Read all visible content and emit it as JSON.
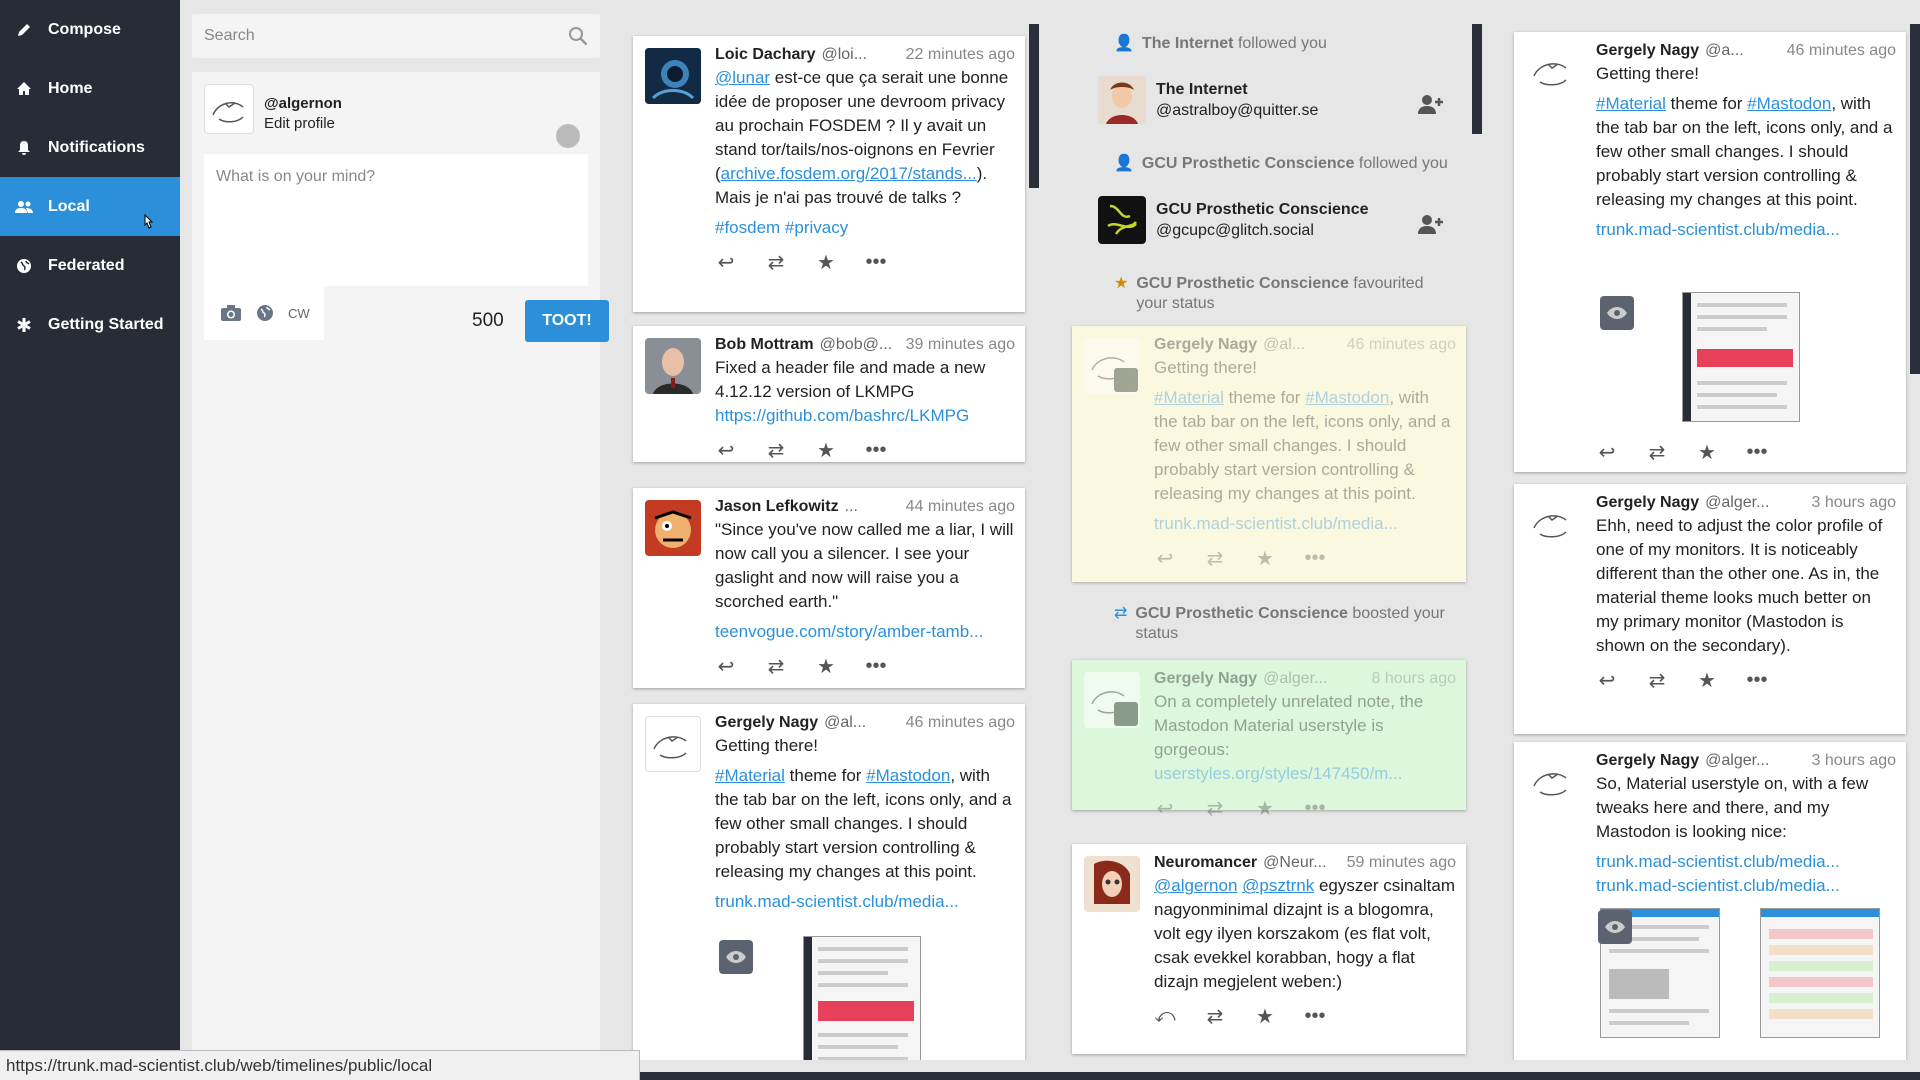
{
  "sidebar": {
    "items": [
      {
        "label": "Compose",
        "icon": "pencil-icon"
      },
      {
        "label": "Home",
        "icon": "home-icon"
      },
      {
        "label": "Notifications",
        "icon": "bell-icon"
      },
      {
        "label": "Local",
        "icon": "users-icon",
        "active": true
      },
      {
        "label": "Federated",
        "icon": "globe-icon"
      },
      {
        "label": "Getting Started",
        "icon": "asterisk-icon"
      }
    ]
  },
  "compose": {
    "search_placeholder": "Search",
    "handle": "@algernon",
    "edit_profile": "Edit profile",
    "placeholder": "What is on your mind?",
    "cw_label": "CW",
    "counter": "500",
    "toot_label": "TOOT!"
  },
  "local": {
    "statuses": [
      {
        "name": "Loic Dachary",
        "acct": "@loi...",
        "time": "22 minutes ago",
        "mention": "@lunar",
        "text1": " est-ce que ça serait une bonne idée de proposer une devroom privacy au prochain FOSDEM ? Il y avait un stand tor/tails/nos-oignons en Fevrier (",
        "link": "archive.fosdem.org/2017/stands...",
        "text2": "). Mais je n'ai pas trouvé de talks ?",
        "tags": "#fosdem #privacy"
      },
      {
        "name": "Bob Mottram",
        "acct": "@bob@...",
        "time": "39 minutes ago",
        "text": "Fixed a header file and made a new 4.12.12 version of LKMPG",
        "link": "https://github.com/bashrc/LKMPG"
      },
      {
        "name": "Jason Lefkowitz",
        "acct": "...",
        "time": "44 minutes ago",
        "text": "\"Since you've now called me a liar, I will now call you a silencer. I see your gaslight and now will raise you a scorched earth.\"",
        "link": "teenvogue.com/story/amber-tamb..."
      },
      {
        "name": "Gergely Nagy",
        "acct": "@al...",
        "time": "46 minutes ago",
        "line1": "Getting there!",
        "tag1": "#Material",
        "mid": " theme for ",
        "tag2": "#Mastodon",
        "rest": ", with the tab bar on the left, icons only, and a few other small changes. I should probably start version controlling & releasing my changes at this point.",
        "link": "trunk.mad-scientist.club/media..."
      }
    ]
  },
  "notifications": {
    "n1": {
      "who": "The Internet",
      "what": "followed you",
      "name": "The Internet",
      "acct": "@astralboy@quitter.se"
    },
    "n2": {
      "who": "GCU Prosthetic Conscience",
      "what": "followed you",
      "name": "GCU Prosthetic Conscience",
      "acct": "@gcupc@glitch.social"
    },
    "n3": {
      "who": "GCU Prosthetic Conscience",
      "what": "favourited your status",
      "name": "Gergely Nagy",
      "acct": "@al...",
      "time": "46 minutes ago",
      "line1": "Getting there!",
      "tag1": "#Material",
      "mid": " theme for ",
      "tag2": "#Mastodon",
      "rest": ", with the tab bar on the left, icons only, and a few other small changes. I should probably start version controlling & releasing my changes at this point.",
      "link": "trunk.mad-scientist.club/media..."
    },
    "n4": {
      "who": "GCU Prosthetic Conscience",
      "what": "boosted your status",
      "name": "Gergely Nagy",
      "acct": "@alger...",
      "time": "8 hours ago",
      "text": "On a completely unrelated note, the Mastodon Material userstyle is gorgeous:",
      "link": "userstyles.org/styles/147450/m..."
    },
    "n5": {
      "name": "Neuromancer",
      "acct": "@Neur...",
      "time": "59 minutes ago",
      "m1": "@algernon",
      "m2": "@psztrnk",
      "text": " egyszer csinaltam nagyonminimal dizajnt is a blogomra, volt egy ilyen korszakom (es flat volt, csak evekkel korabban, hogy a flat dizajn megjelent weben:)"
    }
  },
  "home": {
    "statuses": [
      {
        "name": "Gergely Nagy",
        "acct": "@a...",
        "time": "46 minutes ago",
        "line1": "Getting there!",
        "tag1": "#Material",
        "mid": " theme for ",
        "tag2": "#Mastodon",
        "rest": ", with the tab bar on the left, icons only, and a few other small changes. I should probably start version controlling & releasing my changes at this point.",
        "link": "trunk.mad-scientist.club/media..."
      },
      {
        "name": "Gergely Nagy",
        "acct": "@alger...",
        "time": "3 hours ago",
        "text": "Ehh, need to adjust the color profile of one of my monitors. It is noticeably different than the other one. As in, the material theme looks much better on my primary monitor (Mastodon is shown on the secondary)."
      },
      {
        "name": "Gergely Nagy",
        "acct": "@alger...",
        "time": "3 hours ago",
        "text": "So, Material userstyle on, with a few tweaks here and there, and my Mastodon is looking nice:",
        "link1": "trunk.mad-scientist.club/media...",
        "link2": "trunk.mad-scientist.club/media..."
      }
    ]
  },
  "statusbar": {
    "url": "https://trunk.mad-scientist.club/web/timelines/public/local"
  },
  "colors": {
    "accent": "#2b90d9",
    "sidebar": "#282c37",
    "fav_bg": "#fdfbde",
    "boost_bg": "#ddf7dd"
  }
}
